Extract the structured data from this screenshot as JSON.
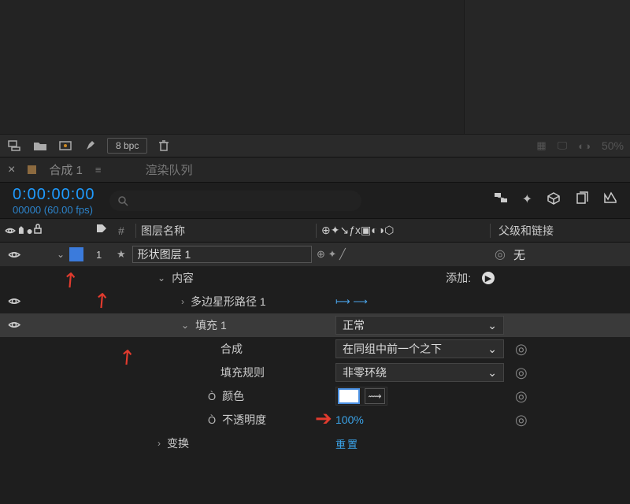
{
  "viewer": {},
  "footer": {
    "bpc_label": "8 bpc",
    "zoom": "50%"
  },
  "tabs": {
    "comp_name": "合成 1",
    "render_queue": "渲染队列"
  },
  "timecode": {
    "value": "0:00:00:00",
    "fps_line": "00000 (60.00 fps)"
  },
  "columns": {
    "layer_name": "图层名称",
    "hash": "#",
    "parent_link": "父级和链接"
  },
  "layer": {
    "index": "1",
    "name": "形状图层 1",
    "parent": "无"
  },
  "props": {
    "contents": "内容",
    "add": "添加:",
    "polystar_path": "多边星形路径 1",
    "fill": "填充 1",
    "fill_mode": "正常",
    "composite": "合成",
    "composite_value": "在同组中前一个之下",
    "fill_rule": "填充规则",
    "fill_rule_value": "非零环绕",
    "color": "颜色",
    "opacity": "不透明度",
    "opacity_value": "100%",
    "transform": "变换",
    "transform_reset": "重置"
  }
}
